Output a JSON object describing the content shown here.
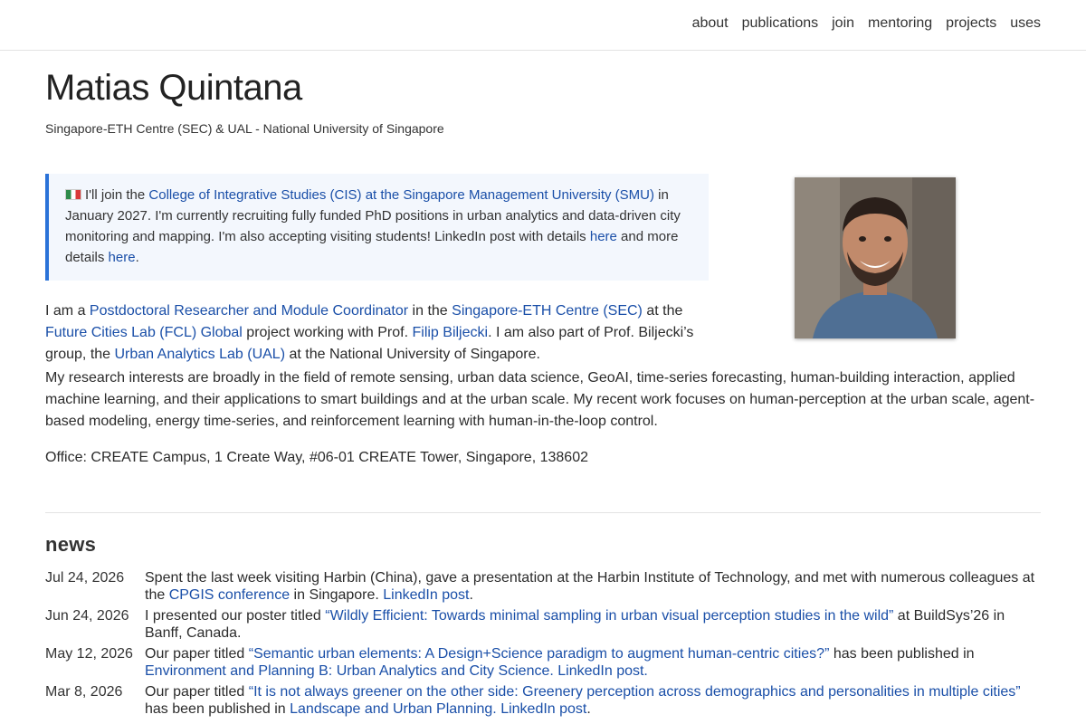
{
  "nav": {
    "links": [
      "about",
      "publications",
      "join",
      "mentoring",
      "projects",
      "uses"
    ]
  },
  "header": {
    "name": "Matias Quintana",
    "affiliation": "Singapore-ETH Centre (SEC) & UAL - National University of Singapore"
  },
  "callout": {
    "flag_icon": "mexico-flag-icon",
    "t1": "I'll join the ",
    "l1": "College of Integrative Studies (CIS) at the Singapore Management University (SMU)",
    "t2": " in January 2027. I'm currently recruiting fully funded PhD positions in urban analytics and data-driven city monitoring and mapping. I'm also accepting visiting students! LinkedIn post with details ",
    "l2": "here",
    "t3": " and more details ",
    "l3": "here",
    "t4": "."
  },
  "bio": {
    "t1": "I am a ",
    "l1": "Postdoctoral Researcher and Module Coordinator",
    "t2": " in the ",
    "l2": "Singapore-ETH Centre (SEC)",
    "t3": " at the ",
    "l3": "Future Cities Lab (FCL) Global",
    "t4": " project working with Prof. ",
    "l4": "Filip Biljecki",
    "t5": ". I am also part of Prof. Biljecki’s group, the ",
    "l5": "Urban Analytics Lab (UAL)",
    "t6": " at the National University of Singapore."
  },
  "interests": "My research interests are broadly in the field of remote sensing, urban data science, GeoAI, time-series forecasting, human-building interaction, applied machine learning, and their applications to smart buildings and at the urban scale. My recent work focuses on human-perception at the urban scale, agent-based modeling, energy time-series, and reinforcement learning with human-in-the-loop control.",
  "office": "Office: CREATE Campus, 1 Create Way, #06-01 CREATE Tower, Singapore, 138602",
  "news": {
    "title": "news",
    "items": [
      {
        "date": "Jul 24, 2026",
        "t1": "Spent the last week visiting Harbin (China), gave a presentation at the Harbin Institute of Technology, and met with numerous colleagues at the ",
        "l1": "CPGIS conference",
        "t2": " in Singapore. ",
        "l2": "LinkedIn post",
        "t3": "."
      },
      {
        "date": "Jun 24, 2026",
        "t1": "I presented our poster titled ",
        "l1": "“Wildly Efficient: Towards minimal sampling in urban visual perception studies in the wild”",
        "t2": " at BuildSys’26 in Banff, Canada.",
        "l2": "",
        "t3": ""
      },
      {
        "date": "May 12, 2026",
        "t1": "Our paper titled ",
        "l1": "“Semantic urban elements: A Design+Science paradigm to augment human-centric cities?”",
        "t2": " has been published in ",
        "l2": "Environment and Planning B: Urban Analytics and City Science. LinkedIn post.",
        "t3": ""
      },
      {
        "date": "Mar 8, 2026",
        "t1": "Our paper titled ",
        "l1": "“It is not always greener on the other side: Greenery perception across demographics and personalities in multiple cities”",
        "t2": " has been published in ",
        "l2": "Landscape and Urban Planning. LinkedIn post",
        "t3": "."
      }
    ]
  }
}
